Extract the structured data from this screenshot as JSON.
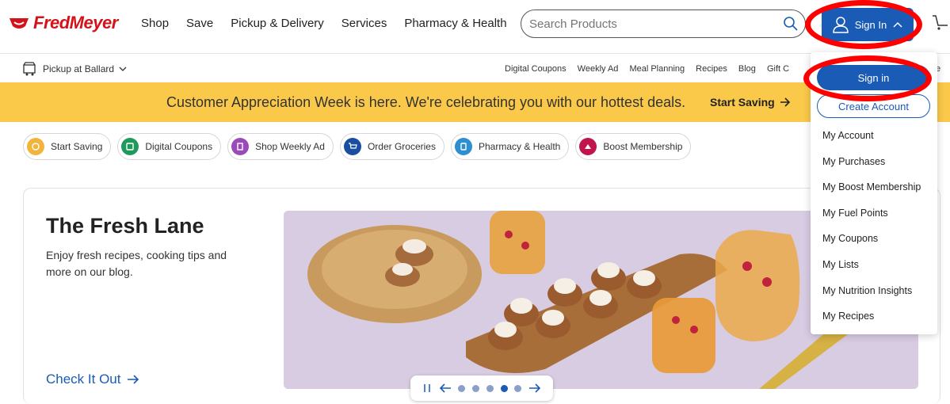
{
  "brand": {
    "name": "FredMeyer",
    "color": "#d3121a"
  },
  "nav": {
    "links": [
      "Shop",
      "Save",
      "Pickup & Delivery",
      "Services",
      "Pharmacy & Health"
    ],
    "search_placeholder": "Search Products",
    "sign_in_label": "Sign In"
  },
  "subnav": {
    "pickup_label": "Pickup at Ballard",
    "links": [
      "Digital Coupons",
      "Weekly Ad",
      "Meal Planning",
      "Recipes",
      "Blog",
      "Gift C"
    ],
    "trailing": "e"
  },
  "banner": {
    "text": "Customer Appreciation Week is here. We're celebrating you with our hottest deals.",
    "cta": "Start Saving",
    "color": "#fbc94a"
  },
  "chips": [
    {
      "label": "Start Saving",
      "icon": "piggy-bank-icon",
      "color": "#f2b43a"
    },
    {
      "label": "Digital Coupons",
      "icon": "coupon-icon",
      "color": "#1f9a5c"
    },
    {
      "label": "Shop Weekly Ad",
      "icon": "weekly-ad-icon",
      "color": "#9a4bb8"
    },
    {
      "label": "Order Groceries",
      "icon": "cart-icon",
      "color": "#1a4fa0"
    },
    {
      "label": "Pharmacy & Health",
      "icon": "pharmacy-icon",
      "color": "#2e8fd0"
    },
    {
      "label": "Boost Membership",
      "icon": "boost-icon",
      "color": "#c0164d"
    }
  ],
  "hero": {
    "title": "The Fresh Lane",
    "description": "Enjoy fresh recipes, cooking tips and more on our blog.",
    "cta": "Check It Out",
    "slides_total": 5,
    "active_slide": 4
  },
  "dropdown": {
    "sign_in": "Sign in",
    "create_account": "Create Account",
    "items": [
      "My Account",
      "My Purchases",
      "My Boost Membership",
      "My Fuel Points",
      "My Coupons",
      "My Lists",
      "My Nutrition Insights",
      "My Recipes"
    ]
  },
  "accent_color": "#1a5bb5"
}
